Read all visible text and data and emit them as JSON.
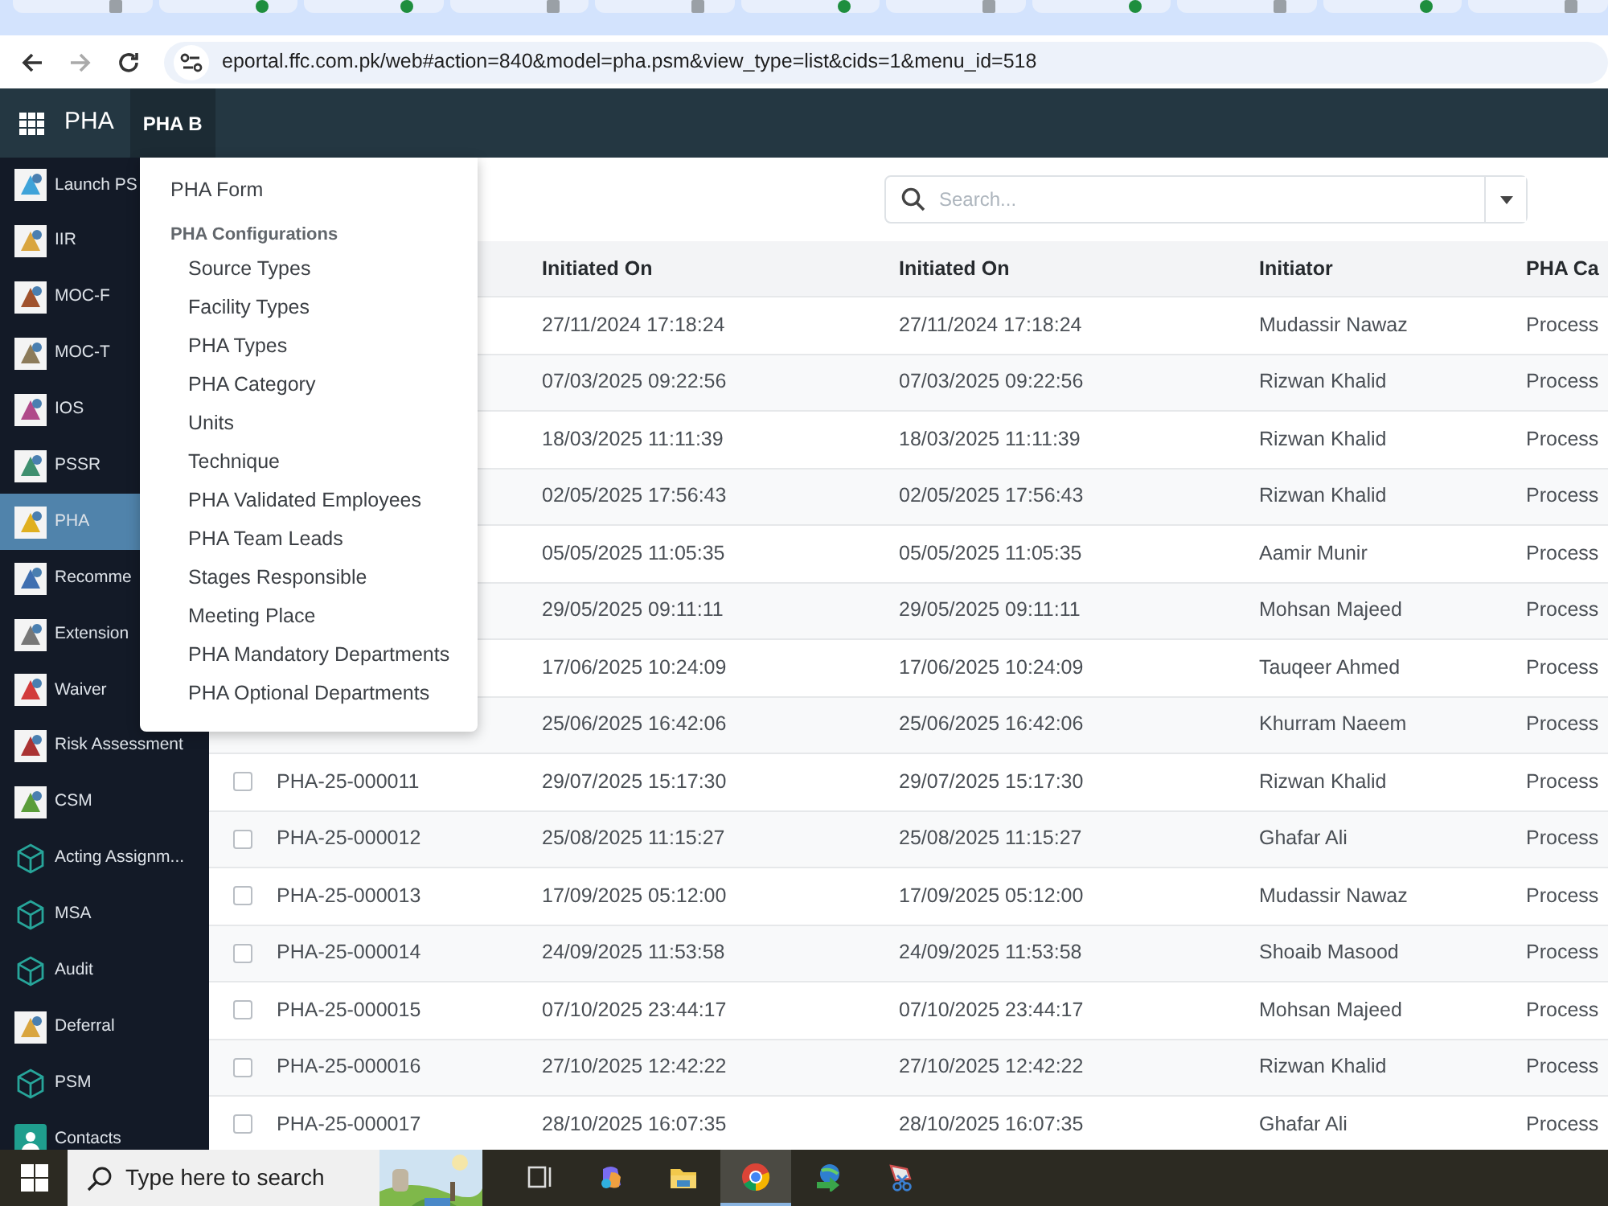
{
  "browser": {
    "tabs": [
      {
        "kind": "page"
      },
      {
        "kind": "check"
      },
      {
        "kind": "check"
      },
      {
        "kind": "page"
      },
      {
        "kind": "page"
      },
      {
        "kind": "check"
      },
      {
        "kind": "page"
      },
      {
        "kind": "check"
      },
      {
        "kind": "page"
      },
      {
        "kind": "check"
      },
      {
        "kind": "page"
      }
    ],
    "url": "eportal.ffc.com.pk/web#action=840&model=pha.psm&view_type=list&cids=1&menu_id=518"
  },
  "navbar": {
    "app": "PHA",
    "menu": [
      {
        "label": "PHA B",
        "selected": true
      }
    ]
  },
  "sidebar": {
    "items": [
      {
        "label": "Launch PS",
        "kind": "tile",
        "selected": false
      },
      {
        "label": "IIR",
        "kind": "tile",
        "selected": false
      },
      {
        "label": "MOC-F",
        "kind": "tile",
        "selected": false
      },
      {
        "label": "MOC-T",
        "kind": "tile",
        "selected": false
      },
      {
        "label": "IOS",
        "kind": "tile",
        "selected": false
      },
      {
        "label": "PSSR",
        "kind": "tile",
        "selected": false
      },
      {
        "label": "PHA",
        "kind": "tile",
        "selected": true
      },
      {
        "label": "Recomme",
        "kind": "tile",
        "selected": false
      },
      {
        "label": "Extension",
        "kind": "tile",
        "selected": false
      },
      {
        "label": "Waiver",
        "kind": "tile",
        "selected": false
      },
      {
        "label": "Risk Assessment",
        "kind": "tile",
        "selected": false
      },
      {
        "label": "CSM",
        "kind": "tile",
        "selected": false
      },
      {
        "label": "Acting Assignm...",
        "kind": "cube",
        "selected": false
      },
      {
        "label": "MSA",
        "kind": "cube",
        "selected": false
      },
      {
        "label": "Audit",
        "kind": "cube",
        "selected": false
      },
      {
        "label": "Deferral",
        "kind": "tile",
        "selected": false
      },
      {
        "label": "PSM",
        "kind": "cube",
        "selected": false
      },
      {
        "label": "Contacts",
        "kind": "contact",
        "selected": false
      }
    ]
  },
  "dropdown": {
    "items": [
      {
        "label": "PHA Form",
        "kind": "item"
      },
      {
        "label": "PHA Configurations",
        "kind": "header"
      },
      {
        "label": "Source Types",
        "kind": "subitem"
      },
      {
        "label": "Facility Types",
        "kind": "subitem"
      },
      {
        "label": "PHA Types",
        "kind": "subitem"
      },
      {
        "label": "PHA Category",
        "kind": "subitem"
      },
      {
        "label": "Units",
        "kind": "subitem"
      },
      {
        "label": "Technique",
        "kind": "subitem"
      },
      {
        "label": "PHA Validated Employees",
        "kind": "subitem"
      },
      {
        "label": "PHA Team Leads",
        "kind": "subitem"
      },
      {
        "label": "Stages Responsible",
        "kind": "subitem"
      },
      {
        "label": "Meeting Place",
        "kind": "subitem"
      },
      {
        "label": "PHA Mandatory Departments",
        "kind": "subitem"
      },
      {
        "label": "PHA Optional Departments",
        "kind": "subitem"
      }
    ]
  },
  "search": {
    "placeholder": "Search..."
  },
  "table": {
    "columns": [
      {
        "label": "Initiated On"
      },
      {
        "label": "Initiated On"
      },
      {
        "label": "Initiator"
      },
      {
        "label": "PHA Ca"
      }
    ],
    "rows": [
      {
        "initiated": "27/11/2024 17:18:24",
        "initiated_2": "27/11/2024 17:18:24",
        "initiator": "Mudassir Nawaz",
        "category": "Process"
      },
      {
        "initiated": "07/03/2025 09:22:56",
        "initiated_2": "07/03/2025 09:22:56",
        "initiator": "Rizwan Khalid",
        "category": "Process"
      },
      {
        "initiated": "18/03/2025 11:11:39",
        "initiated_2": "18/03/2025 11:11:39",
        "initiator": "Rizwan Khalid",
        "category": "Process"
      },
      {
        "initiated": "02/05/2025 17:56:43",
        "initiated_2": "02/05/2025 17:56:43",
        "initiator": "Rizwan Khalid",
        "category": "Process"
      },
      {
        "initiated": "05/05/2025 11:05:35",
        "initiated_2": "05/05/2025 11:05:35",
        "initiator": "Aamir Munir",
        "category": "Process"
      },
      {
        "initiated": "29/05/2025 09:11:11",
        "initiated_2": "29/05/2025 09:11:11",
        "initiator": "Mohsan Majeed",
        "category": "Process"
      },
      {
        "initiated": "17/06/2025 10:24:09",
        "initiated_2": "17/06/2025 10:24:09",
        "initiator": "Tauqeer Ahmed",
        "category": "Process"
      },
      {
        "initiated": "25/06/2025 16:42:06",
        "initiated_2": "25/06/2025 16:42:06",
        "initiator": "Khurram Naeem",
        "category": "Process"
      },
      {
        "id": "PHA-25-000011",
        "checked": false,
        "initiated": "29/07/2025 15:17:30",
        "initiated_2": "29/07/2025 15:17:30",
        "initiator": "Rizwan Khalid",
        "category": "Process"
      },
      {
        "id": "PHA-25-000012",
        "checked": false,
        "initiated": "25/08/2025 11:15:27",
        "initiated_2": "25/08/2025 11:15:27",
        "initiator": "Ghafar Ali",
        "category": "Process"
      },
      {
        "id": "PHA-25-000013",
        "checked": false,
        "initiated": "17/09/2025 05:12:00",
        "initiated_2": "17/09/2025 05:12:00",
        "initiator": "Mudassir Nawaz",
        "category": "Process"
      },
      {
        "id": "PHA-25-000014",
        "checked": false,
        "initiated": "24/09/2025 11:53:58",
        "initiated_2": "24/09/2025 11:53:58",
        "initiator": "Shoaib Masood",
        "category": "Process"
      },
      {
        "id": "PHA-25-000015",
        "checked": false,
        "initiated": "07/10/2025 23:44:17",
        "initiated_2": "07/10/2025 23:44:17",
        "initiator": "Mohsan Majeed",
        "category": "Process"
      },
      {
        "id": "PHA-25-000016",
        "checked": false,
        "initiated": "27/10/2025 12:42:22",
        "initiated_2": "27/10/2025 12:42:22",
        "initiator": "Rizwan Khalid",
        "category": "Process"
      },
      {
        "id": "PHA-25-000017",
        "checked": false,
        "initiated": "28/10/2025 16:07:35",
        "initiated_2": "28/10/2025 16:07:35",
        "initiator": "Ghafar Ali",
        "category": "Process"
      }
    ]
  },
  "taskbar": {
    "search_placeholder": "Type here to search",
    "apps": [
      {
        "kind": "taskview",
        "active": false
      },
      {
        "kind": "copilot",
        "active": false
      },
      {
        "kind": "folder",
        "active": false
      },
      {
        "kind": "chrome",
        "active": true
      },
      {
        "kind": "download",
        "active": false
      },
      {
        "kind": "snip",
        "active": false
      }
    ]
  }
}
